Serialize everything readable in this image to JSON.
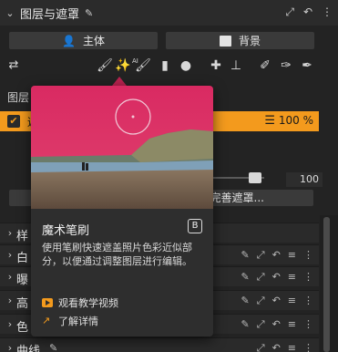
{
  "panel": {
    "title": "图层与遮罩",
    "mask_subject_label": "主体",
    "mask_background_label": "背景",
    "layers_label": "图层",
    "layer_name_fragment": "遮",
    "layer_opacity": "100 %",
    "slider_value": "100",
    "refine_label": "完善遮罩..."
  },
  "toolbar": {
    "ai_badge": "AI"
  },
  "adjustments": [
    {
      "name": "样"
    },
    {
      "name": "白"
    },
    {
      "name": "曝"
    },
    {
      "name": "高"
    },
    {
      "name": "色"
    },
    {
      "name": "曲线"
    }
  ],
  "tooltip": {
    "title": "魔术笔刷",
    "shortcut": "B",
    "description": "使用笔刷快速遮盖照片色彩近似部分，以便通过调整图层进行编辑。",
    "link_video": "观看教学视频",
    "link_more": "了解详情"
  },
  "colors": {
    "accent": "#f39a1d",
    "link_icon": "#f39a1d"
  }
}
